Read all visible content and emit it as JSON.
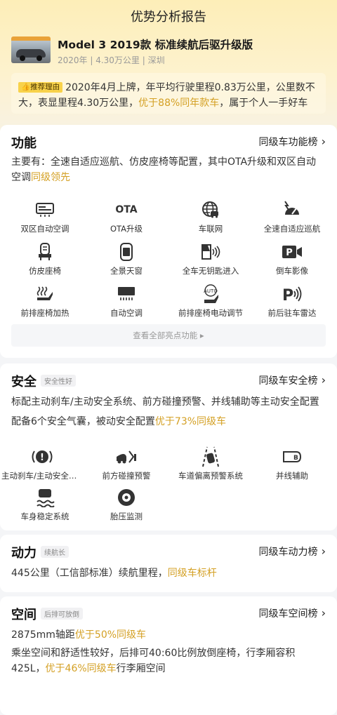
{
  "page": {
    "title": "优势分析报告"
  },
  "car": {
    "name": "Model 3 2019款 标准续航后驱升级版",
    "meta": "2020年 | 4.30万公里 | 深圳"
  },
  "reason": {
    "tag": "推荐理由",
    "part1": "2020年4月上牌，年平均行驶里程0.83万公里，公里数不大，表显里程4.30万公里，",
    "highlight": "优于88%同年款车",
    "part2": "，属于个人一手好车"
  },
  "features": {
    "title": "功能",
    "rank": "同级车功能榜",
    "desc": "主要有：全速自适应巡航、仿皮座椅等配置，其中OTA升级和双区自动空调",
    "desc_hl": "同级领先",
    "items": [
      {
        "label": "双区自动空调",
        "icon": "dual-zone-ac-icon"
      },
      {
        "label": "OTA升级",
        "icon": "ota-icon",
        "icon_text": "OTA"
      },
      {
        "label": "车联网",
        "icon": "connected-car-icon"
      },
      {
        "label": "全速自适应巡航",
        "icon": "adaptive-cruise-icon"
      },
      {
        "label": "仿皮座椅",
        "icon": "leather-seat-icon"
      },
      {
        "label": "全景天窗",
        "icon": "panoramic-sunroof-icon"
      },
      {
        "label": "全车无钥匙进入",
        "icon": "keyless-entry-icon"
      },
      {
        "label": "倒车影像",
        "icon": "reverse-camera-icon"
      },
      {
        "label": "前排座椅加热",
        "icon": "seat-heating-icon"
      },
      {
        "label": "自动空调",
        "icon": "auto-ac-icon"
      },
      {
        "label": "前排座椅电动调节",
        "icon": "power-seat-icon",
        "icon_text": "AUTO"
      },
      {
        "label": "前后驻车雷达",
        "icon": "parking-radar-icon"
      }
    ],
    "view_all": "查看全部亮点功能"
  },
  "safety": {
    "title": "安全",
    "tag": "安全性好",
    "rank": "同级车安全榜",
    "line1": "标配主动刹车/主动安全系统、前方碰撞预警、并线辅助等主动安全配置",
    "line2": "配备6个安全气囊，被动安全配置",
    "line2_hl": "优于73%同级车",
    "items": [
      {
        "label": "主动刹车/主动安全系统",
        "icon": "active-brake-icon"
      },
      {
        "label": "前方碰撞预警",
        "icon": "collision-warning-icon"
      },
      {
        "label": "车道偏离预警系统",
        "icon": "lane-departure-icon"
      },
      {
        "label": "并线辅助",
        "icon": "blind-spot-icon"
      },
      {
        "label": "车身稳定系统",
        "icon": "stability-control-icon"
      },
      {
        "label": "胎压监测",
        "icon": "tire-pressure-icon"
      }
    ]
  },
  "power": {
    "title": "动力",
    "tag": "续航长",
    "rank": "同级车动力榜",
    "desc": "445公里（工信部标准）续航里程，",
    "desc_hl": "同级车标杆"
  },
  "space": {
    "title": "空间",
    "tag": "后排可放倒",
    "rank": "同级车空间榜",
    "line1": "2875mm轴距",
    "line1_hl": "优于50%同级车",
    "line2": "乘坐空间和舒适性较好，后排可40:60比例放倒座椅，行李厢容积425L，",
    "line2_hl": "优于46%同级车",
    "line2_tail": "行李厢空间"
  },
  "colors": {
    "accent": "#d4a024",
    "tag_yellow": "#f8d24a"
  }
}
